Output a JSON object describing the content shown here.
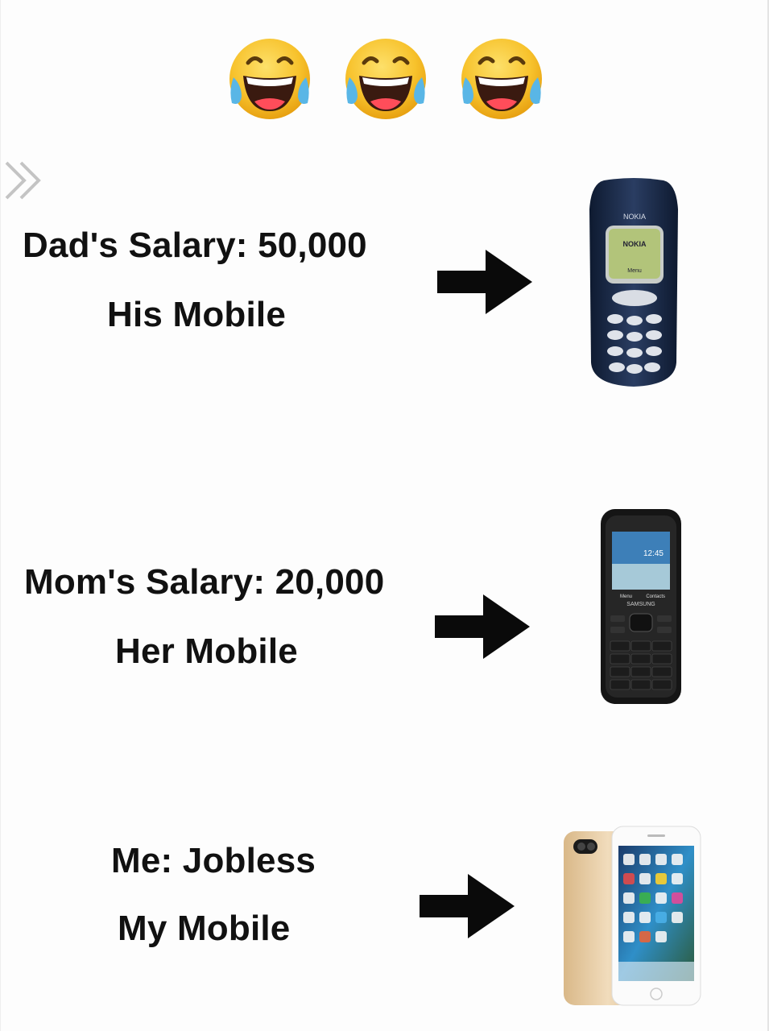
{
  "emojis": [
    "face-with-tears-of-joy",
    "face-with-tears-of-joy",
    "face-with-tears-of-joy"
  ],
  "rows": [
    {
      "line1": "Dad's Salary: 50,000",
      "line2": "His Mobile",
      "phone": "nokia-3310"
    },
    {
      "line1": "Mom's Salary: 20,000",
      "line2": "Her Mobile",
      "phone": "samsung-keypad"
    },
    {
      "line1": "Me: Jobless",
      "line2": "My Mobile",
      "phone": "iphone-7-plus"
    }
  ],
  "phone_text": {
    "nokia_brand": "NOKIA",
    "nokia_screen": "NOKIA",
    "nokia_menu": "Menu",
    "samsung_time": "12:45",
    "samsung_brand": "SAMSUNG",
    "samsung_left": "Menu",
    "samsung_right": "Contacts"
  },
  "colors": {
    "arrow": "#0a0a0a",
    "emoji_face": "#f7c22c",
    "tears": "#59b6e6",
    "iphone_gold": "#e8c9a0"
  }
}
